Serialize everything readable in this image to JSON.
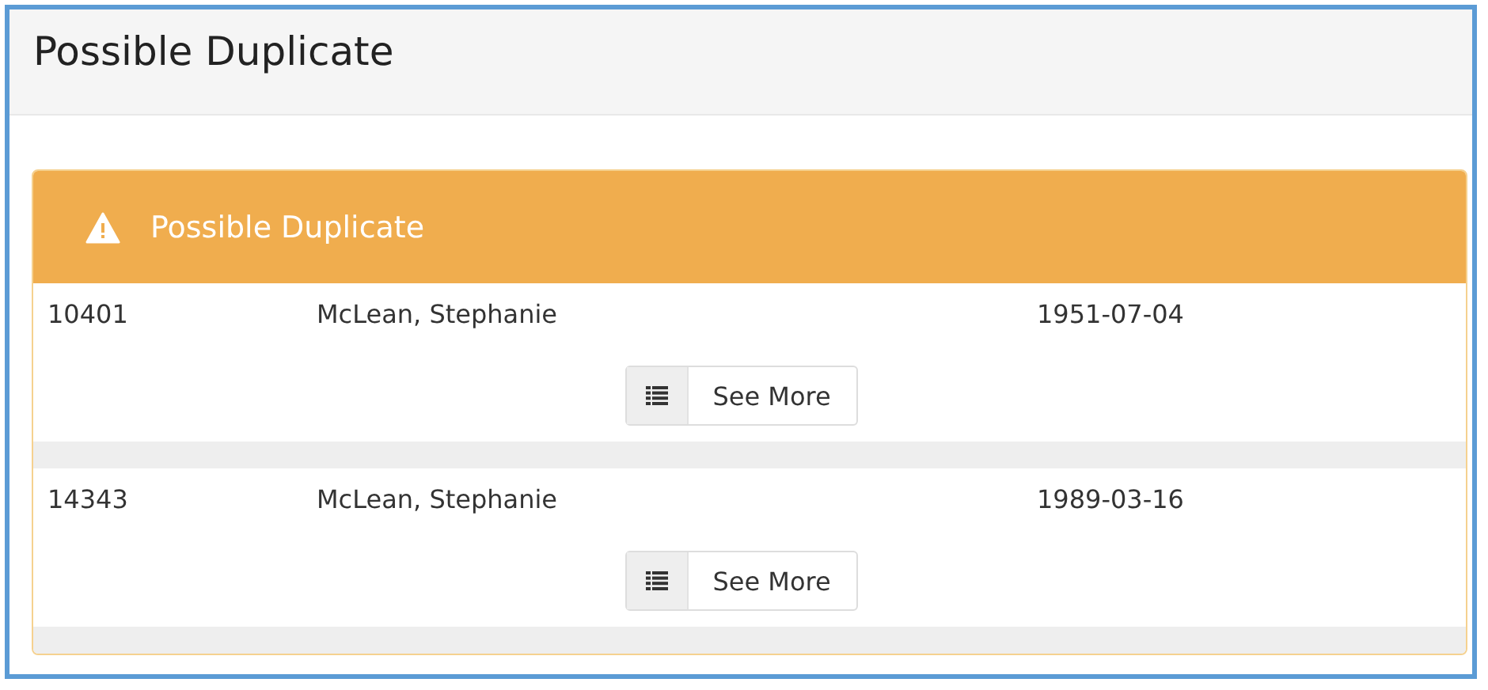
{
  "page": {
    "title": "Possible Duplicate"
  },
  "panel": {
    "title": "Possible Duplicate",
    "records": [
      {
        "id": "10401",
        "name": "McLean, Stephanie",
        "date": "1951-07-04",
        "button": "See More"
      },
      {
        "id": "14343",
        "name": "McLean, Stephanie",
        "date": "1989-03-16",
        "button": "See More"
      }
    ]
  }
}
